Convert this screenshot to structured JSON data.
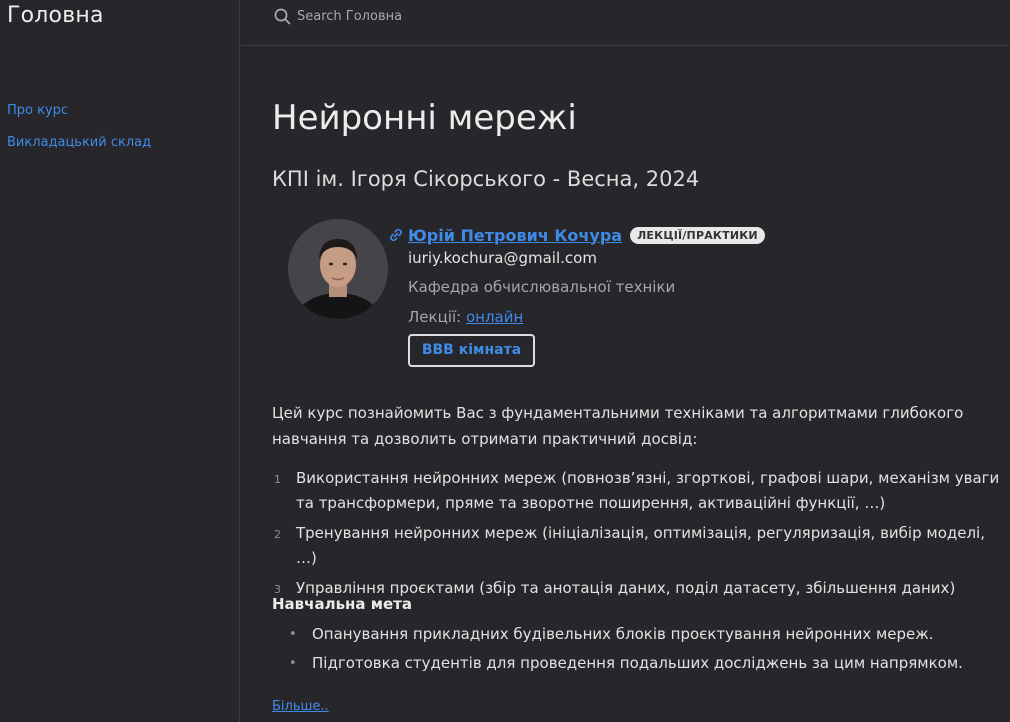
{
  "site": {
    "title": "Головна"
  },
  "search": {
    "placeholder": "Search Головна"
  },
  "sidebar": {
    "items": [
      {
        "label": "Про курс"
      },
      {
        "label": "Викладацький склад"
      }
    ]
  },
  "main": {
    "title": "Нейронні мережі",
    "subtitle": "КПІ ім. Ігоря Сікорського - Весна, 2024",
    "instructor": {
      "name": "Юрій Петрович Кочура",
      "role": "ЛЕКЦІЇ/ПРАКТИКИ",
      "email": "iuriy.kochura@gmail.com",
      "department": "Кафедра обчислювальної техніки",
      "lectures_label": "Лекції:",
      "lectures_link": "онлайн",
      "room_button": "BBB кімната"
    },
    "description": "Цей курс познайомить Вас з фундаментальними техніками та алгоритмами глибокого навчання та дозволить отримати практичний досвід:",
    "topics": [
      {
        "num": "1",
        "text": "Використання нейронних мереж (повнозв’язні, згорткові, графові шари, механізм уваги та трансформери, пряме та зворотне поширення, активаційні функції, …)"
      },
      {
        "num": "2",
        "text": "Тренування нейронних мереж (ініціалізація, оптимізація, регуляризація, вибір моделі, …)"
      },
      {
        "num": "3",
        "text": "Управління проєктами (збір та анотація даних, поділ датасету, збільшення даних)"
      }
    ],
    "goals_title": "Навчальна мета",
    "goals": [
      "Опанування прикладних будівельних блоків проєктування нейронних мереж.",
      "Підготовка студентів для проведення подальших досліджень за цим напрямком."
    ],
    "more_link": "Більше.."
  },
  "colors": {
    "background": "#27262b",
    "accent": "#3f8be8",
    "text": "#e2e2e2",
    "muted": "#a6a6aa"
  },
  "icons": [
    "search-icon",
    "link-icon",
    "avatar-photo"
  ]
}
